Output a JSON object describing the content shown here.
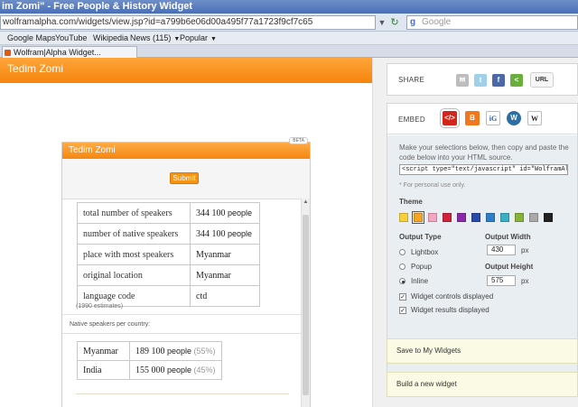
{
  "browser": {
    "title": "im Zomi\" - Free People & History Widget",
    "url": "wolframalpha.com/widgets/view.jsp?id=a799b6e06d00a495f77a1723f9cf7c65",
    "search_placeholder": "Google",
    "bookmarks": [
      "Google Maps",
      "YouTube",
      "Wikipedia",
      "News (115)",
      "Popular"
    ],
    "tab_label": "Wolfram|Alpha Widget..."
  },
  "preview": {
    "header": "Tedim Zomi",
    "widget": {
      "title": "Tedim Zomi",
      "beta": "BETA",
      "submit": "Submit",
      "properties": [
        {
          "key": "total number of speakers",
          "value": "344 100",
          "unit": "people"
        },
        {
          "key": "number of native speakers",
          "value": "344 100",
          "unit": "people"
        },
        {
          "key": "place with most speakers",
          "value": "Myanmar",
          "unit": ""
        },
        {
          "key": "original location",
          "value": "Myanmar",
          "unit": ""
        },
        {
          "key": "language code",
          "value": "ctd",
          "unit": ""
        }
      ],
      "estimate_note": "(1990 estimates)",
      "pod_title": "Native speakers per country:",
      "speakers": [
        {
          "country": "Myanmar",
          "value": "189 100",
          "unit": "people",
          "pct": "(55%)"
        },
        {
          "country": "India",
          "value": "155 000",
          "unit": "people",
          "pct": "(45%)"
        }
      ]
    }
  },
  "panel": {
    "share_label": "SHARE",
    "url_button": "URL",
    "embed_label": "EMBED",
    "instructions": "Make your selections below, then copy and paste the code below into your HTML source.",
    "code": "<script type=\"text/javascript\" id=\"WolframAlphaScri",
    "personal_note": "* For personal use only.",
    "theme_label": "Theme",
    "theme_colors": [
      "#f7d13c",
      "#f5a623",
      "#f4a6c0",
      "#d0243b",
      "#8a2aa8",
      "#2a4aa8",
      "#2f7fc8",
      "#3ab0c7",
      "#88b33a",
      "#a9a9a9",
      "#222222"
    ],
    "theme_selected": 1,
    "output_type_label": "Output Type",
    "output_types": [
      "Lightbox",
      "Popup",
      "Inline"
    ],
    "output_type_selected": 2,
    "output_width_label": "Output Width",
    "output_width": "430",
    "output_height_label": "Output Height",
    "output_height": "575",
    "px": "px",
    "checkboxes": [
      "Widget controls displayed",
      "Widget results displayed"
    ],
    "save_label": "Save to My Widgets",
    "build_label": "Build a new widget"
  }
}
